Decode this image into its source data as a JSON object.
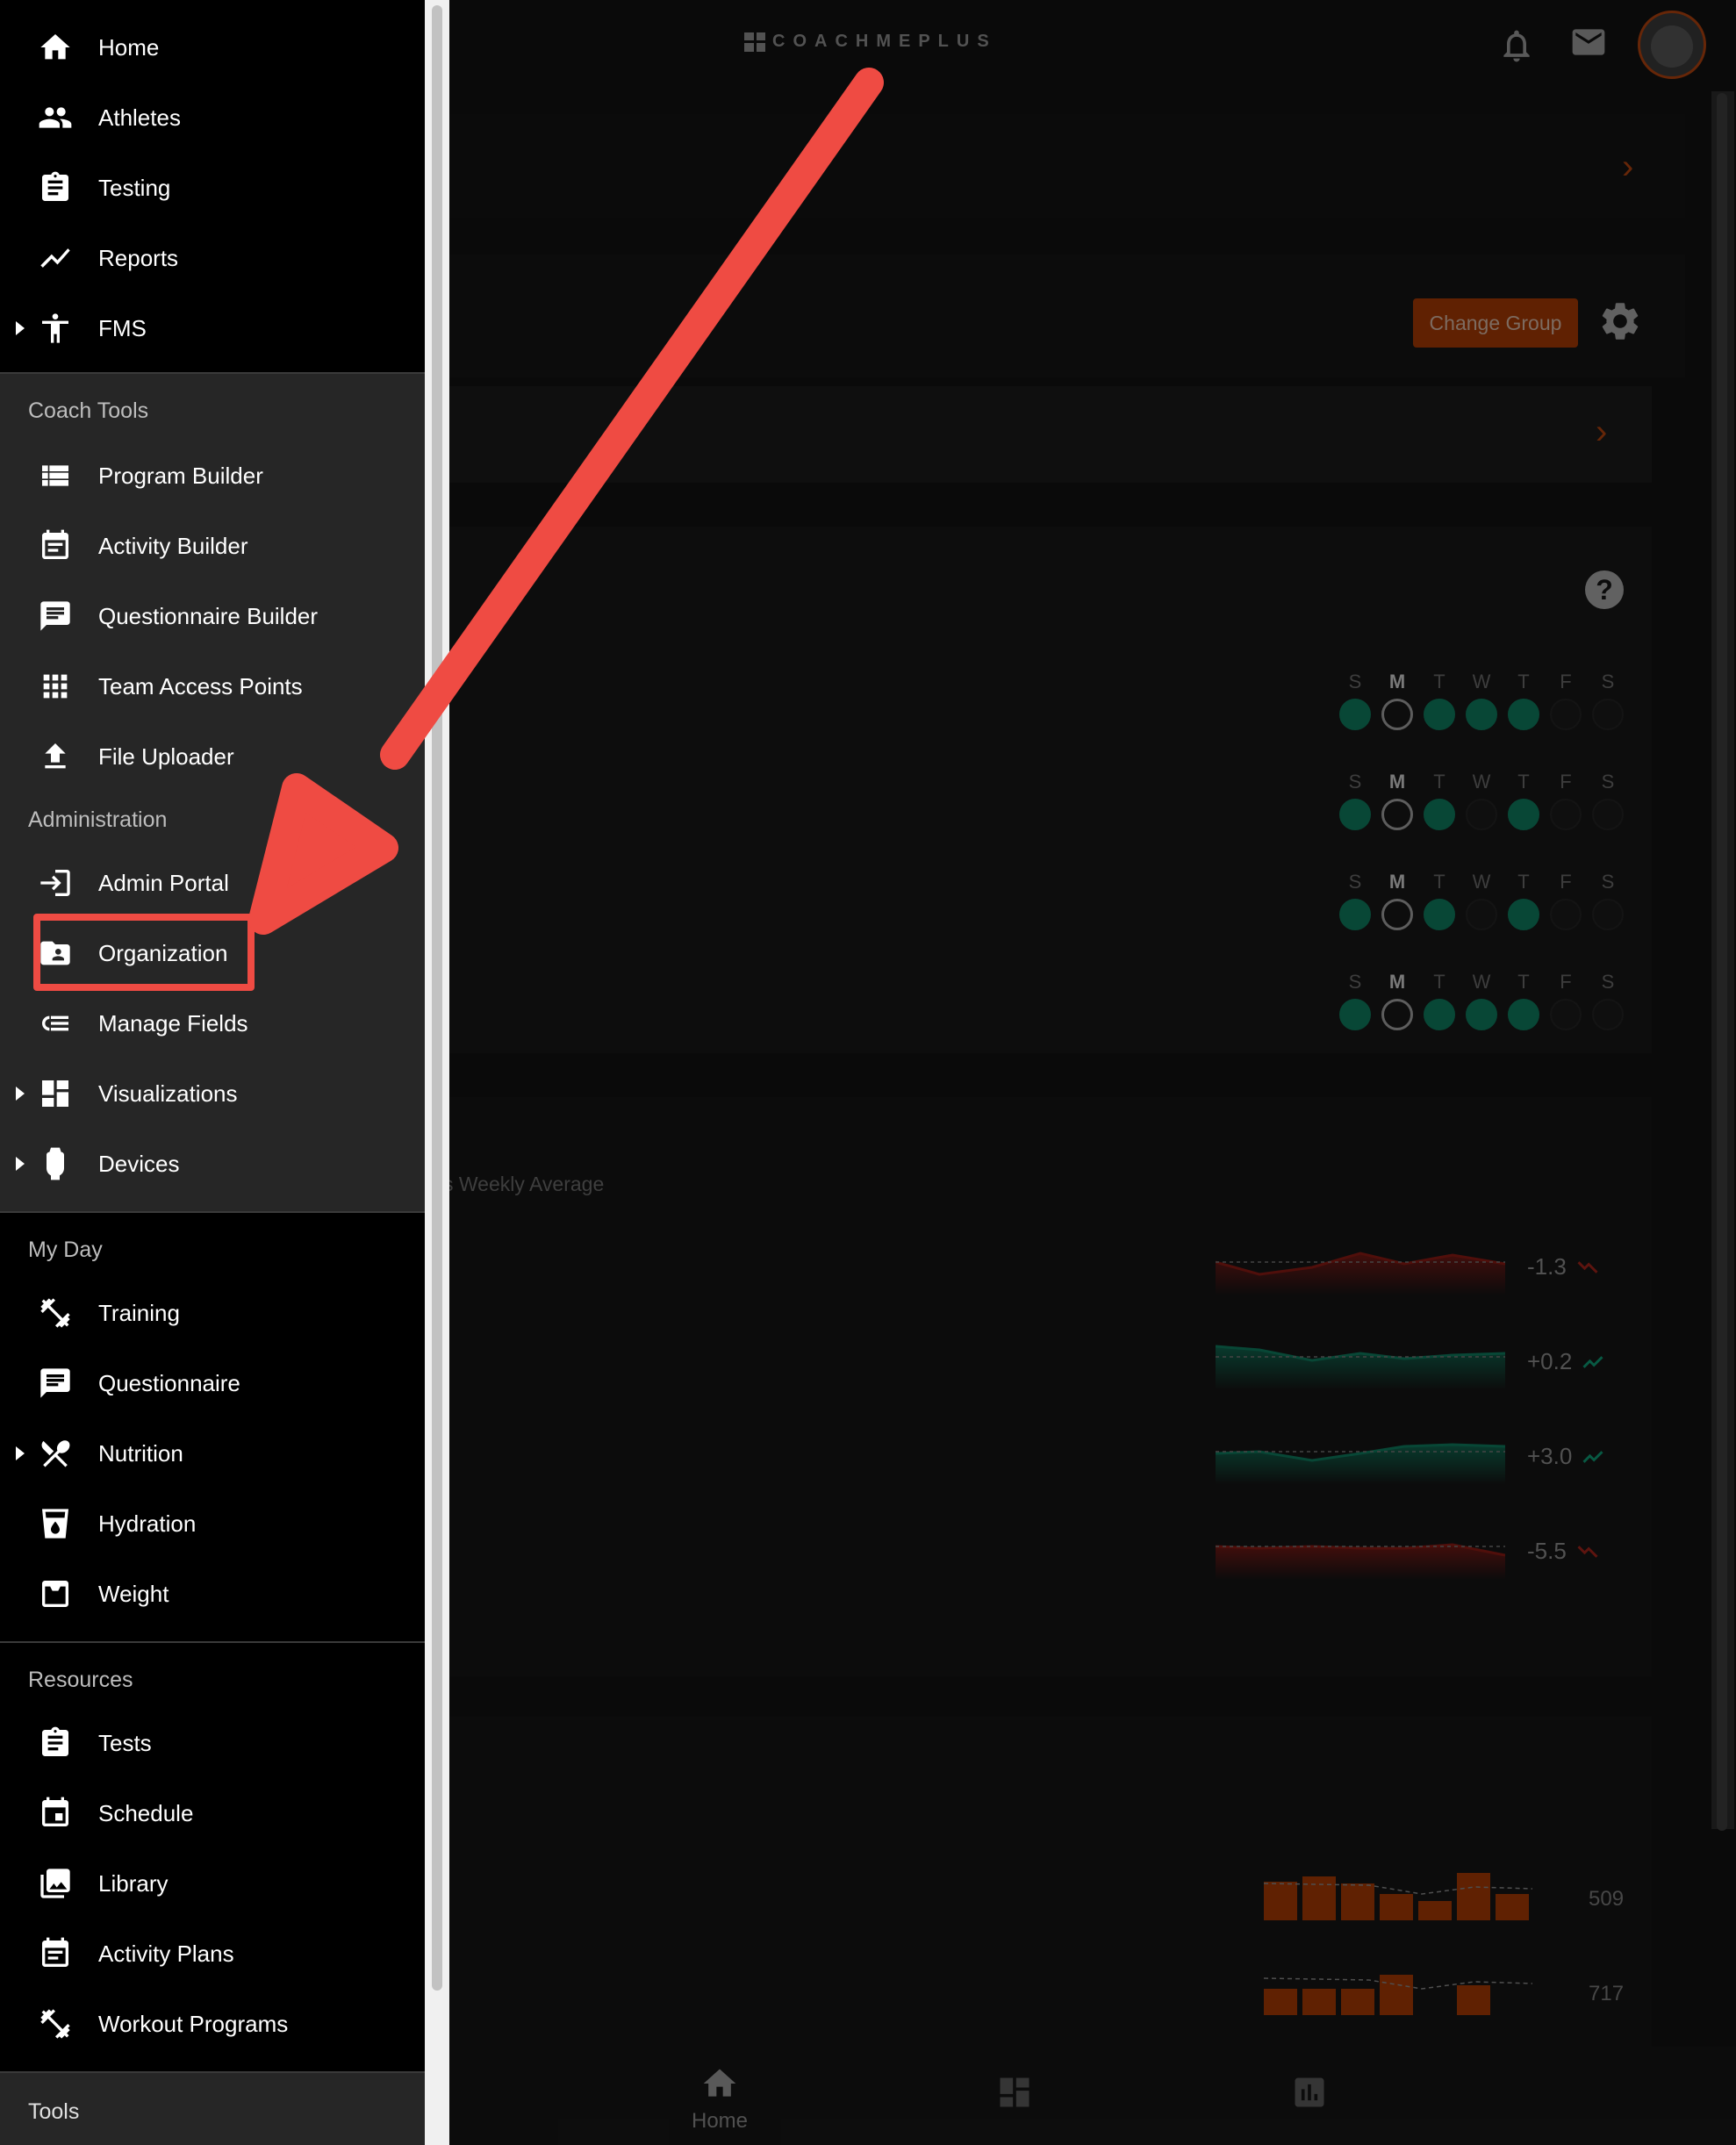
{
  "app": {
    "logo_text": "COACHMEPLUS",
    "change_group_label": "Change Group",
    "weekly_subtitle": "s Weekly Average",
    "week_days": [
      "S",
      "M",
      "T",
      "W",
      "T",
      "F",
      "S"
    ],
    "week_rows": [
      [
        "g",
        "c",
        "g",
        "g",
        "g",
        "e",
        "e"
      ],
      [
        "g",
        "c",
        "g",
        "e",
        "g",
        "e",
        "e"
      ],
      [
        "g",
        "c",
        "g",
        "e",
        "g",
        "e",
        "e"
      ],
      [
        "g",
        "c",
        "g",
        "g",
        "g",
        "e",
        "e"
      ]
    ],
    "trends": [
      {
        "value": "-1.3",
        "direction": "down",
        "color": "#8b1a14"
      },
      {
        "value": "+0.2",
        "direction": "up",
        "color": "#0e7a5d"
      },
      {
        "value": "+3.0",
        "direction": "up",
        "color": "#0e7a5d"
      },
      {
        "value": "-5.5",
        "direction": "down",
        "color": "#8b1a14"
      }
    ],
    "bar_values": [
      "509",
      "717"
    ],
    "bottom_nav": [
      {
        "label": "Home",
        "icon": "home-icon"
      },
      {
        "label": "",
        "icon": "dashboard-icon"
      },
      {
        "label": "",
        "icon": "chart-icon"
      }
    ],
    "accent_color": "#a63a05"
  },
  "drawer": {
    "top_items": [
      {
        "label": "Home",
        "icon": "home-icon"
      },
      {
        "label": "Athletes",
        "icon": "people-icon"
      },
      {
        "label": "Testing",
        "icon": "clipboard-icon"
      },
      {
        "label": "Reports",
        "icon": "trend-line-icon"
      },
      {
        "label": "FMS",
        "icon": "accessibility-icon",
        "expandable": true
      }
    ],
    "coach_tools": {
      "title": "Coach Tools",
      "items": [
        {
          "label": "Program Builder",
          "icon": "list-icon"
        },
        {
          "label": "Activity Builder",
          "icon": "calendar-note-icon"
        },
        {
          "label": "Questionnaire Builder",
          "icon": "message-icon"
        },
        {
          "label": "Team Access Points",
          "icon": "grid-icon"
        },
        {
          "label": "File Uploader",
          "icon": "upload-icon"
        }
      ]
    },
    "administration": {
      "title": "Administration",
      "items": [
        {
          "label": "Admin Portal",
          "icon": "login-icon"
        },
        {
          "label": "Organization",
          "icon": "folder-person-icon",
          "highlighted": true
        },
        {
          "label": "Manage Fields",
          "icon": "checklist-icon"
        },
        {
          "label": "Visualizations",
          "icon": "dashboard-icon",
          "expandable": true
        },
        {
          "label": "Devices",
          "icon": "watch-icon",
          "expandable": true
        }
      ]
    },
    "my_day": {
      "title": "My Day",
      "items": [
        {
          "label": "Training",
          "icon": "dumbbell-icon"
        },
        {
          "label": "Questionnaire",
          "icon": "message-icon"
        },
        {
          "label": "Nutrition",
          "icon": "utensils-icon",
          "expandable": true
        },
        {
          "label": "Hydration",
          "icon": "cup-icon"
        },
        {
          "label": "Weight",
          "icon": "scale-icon"
        }
      ]
    },
    "resources": {
      "title": "Resources",
      "items": [
        {
          "label": "Tests",
          "icon": "clipboard-icon"
        },
        {
          "label": "Schedule",
          "icon": "calendar-icon"
        },
        {
          "label": "Library",
          "icon": "photo-library-icon"
        },
        {
          "label": "Activity Plans",
          "icon": "calendar-note-icon"
        },
        {
          "label": "Workout Programs",
          "icon": "dumbbell-icon"
        }
      ]
    },
    "tools": {
      "title": "Tools"
    }
  },
  "annotation": {
    "color": "#ef4b43",
    "target": "Organization"
  }
}
